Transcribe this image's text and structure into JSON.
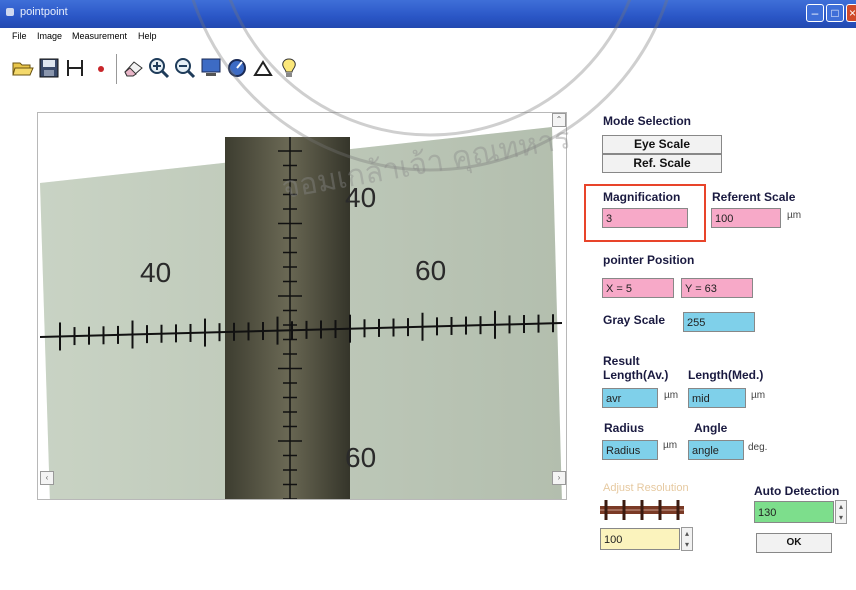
{
  "window": {
    "title": "pointpoint",
    "colors": {
      "titlebar": "#2a56c6"
    }
  },
  "menu": {
    "file": "File",
    "image": "Image",
    "measurement": "Measurement",
    "help": "Help"
  },
  "toolbar": {
    "icons": [
      "open-folder-icon",
      "save-disk-icon",
      "measure-bracket-icon",
      "point-dot-icon",
      "eraser-icon",
      "zoom-in-icon",
      "zoom-out-icon",
      "monitor-icon",
      "angle-circle-icon",
      "triangle-icon",
      "bulb-icon"
    ]
  },
  "image_view": {
    "ruler_labels": {
      "top": "40",
      "left": "40",
      "right": "60",
      "bottom": "60"
    }
  },
  "mode": {
    "label": "Mode Selection",
    "eye_scale": "Eye Scale",
    "ref_scale": "Ref. Scale"
  },
  "magnification": {
    "label": "Magnification",
    "value": "3"
  },
  "referent_scale": {
    "label": "Referent Scale",
    "value": "100",
    "unit": "µm"
  },
  "pointer": {
    "label": "pointer Position",
    "x": "X = 5",
    "y": "Y = 63"
  },
  "gray_scale": {
    "label": "Gray Scale",
    "value": "255"
  },
  "result": {
    "label": "Result",
    "length_av_label": "Length(Av.)",
    "length_med_label": "Length(Med.)",
    "avr": "avr",
    "mid": "mid",
    "unit": "µm",
    "radius_label": "Radius",
    "angle_label": "Angle",
    "radius": "Radius",
    "angle": "angle",
    "deg": "deg."
  },
  "adjust": {
    "label": "Adjust Resolution",
    "value": "100"
  },
  "auto_detection": {
    "label": "Auto Detection",
    "value": "130",
    "ok": "OK"
  },
  "watermark": {
    "text": "จอมเกล้าเจ้า คุณทหาร"
  }
}
